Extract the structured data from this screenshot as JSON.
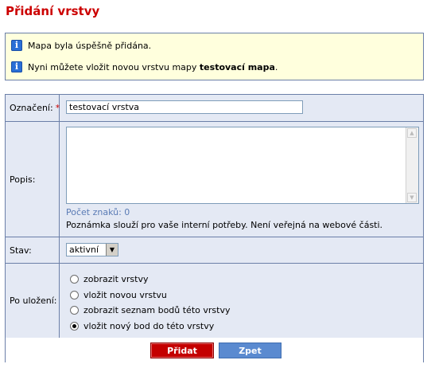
{
  "page": {
    "title": "Přidání vrstvy"
  },
  "info": {
    "messages": [
      {
        "icon": "info-icon",
        "text": "Mapa byla úspěšně přidána."
      },
      {
        "icon": "info-icon",
        "text_prefix": "Nyni můžete vložit novou vrstvu mapy ",
        "map_name": "testovací mapa",
        "text_suffix": "."
      }
    ]
  },
  "form": {
    "name": {
      "label": "Označení:",
      "required_mark": "*",
      "value": "testovací vrstva"
    },
    "description": {
      "label": "Popis:",
      "value": "",
      "counter": "Počet znaků: 0",
      "note": "Poznámka slouží pro vaše interní potřeby. Není veřejná na webové části."
    },
    "state": {
      "label": "Stav:",
      "selected": "aktivní"
    },
    "after_save": {
      "label": "Po uložení:",
      "options": [
        {
          "label": "zobrazit vrstvy",
          "checked": false
        },
        {
          "label": "vložit novou vrstvu",
          "checked": false
        },
        {
          "label": "zobrazit seznam bodů této vrstvy",
          "checked": false
        },
        {
          "label": "vložit nový bod do této vrstvy",
          "checked": true
        }
      ]
    },
    "buttons": {
      "submit": "Přidat",
      "back": "Zpet"
    }
  }
}
